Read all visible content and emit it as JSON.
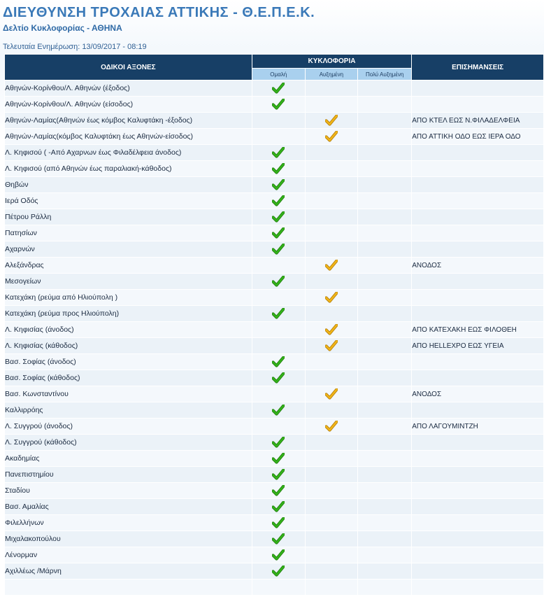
{
  "header": {
    "title": "ΔΙΕΥΘΥΝΣΗ ΤΡΟΧΑΙΑΣ ΑΤΤΙΚΗΣ - Θ.Ε.Π.Ε.Κ.",
    "subtitle": "Δελτίο Κυκλοφορίας - ΑΘΗΝΑ",
    "updated_label": "Τελευταία Ενημέρωση:",
    "updated_value": "13/09/2017 - 08:19"
  },
  "table": {
    "col_roads": "ΟΔΙΚΟΙ ΑΞΟΝΕΣ",
    "col_traffic": "ΚΥΚΛΟΦΟΡΙΑ",
    "col_notes": "ΕΠΙΣΗΜΑΝΣΕΙΣ",
    "levels": [
      "Ομαλή",
      "Αυξημένη",
      "Πολύ Αυξημένη"
    ],
    "rows": [
      {
        "road": "Αθηνών-Κορίνθου/Λ. Αθηνών (έξοδος)",
        "level": 0,
        "note": ""
      },
      {
        "road": "Αθηνών-Κορίνθου/Λ. Αθηνών (είσοδος)",
        "level": 0,
        "note": ""
      },
      {
        "road": "Αθηνών-Λαμίας(Αθηνών έως κόμβος Καλυφτάκη -έξοδος)",
        "level": 1,
        "note": "ΑΠΟ ΚΤΕΛ ΕΩΣ Ν.ΦΙΛΑΔΕΛΦΕΙΑ"
      },
      {
        "road": "Αθηνών-Λαμίας(κόμβος Καλυφτάκη έως Αθηνών-είσοδος)",
        "level": 1,
        "note": "ΑΠΟ ΑΤΤΙΚΗ ΟΔΟ ΕΩΣ ΙΕΡΑ ΟΔΟ"
      },
      {
        "road": "Λ. Κηφισού ( -Από Αχαρνων έως Φιλαδέλφεια άνοδος)",
        "level": 0,
        "note": ""
      },
      {
        "road": "Λ. Κηφισού (από Αθηνών έως παραλιακή-κάθοδος)",
        "level": 0,
        "note": ""
      },
      {
        "road": "Θηβών",
        "level": 0,
        "note": ""
      },
      {
        "road": "Ιερά Οδός",
        "level": 0,
        "note": ""
      },
      {
        "road": "Πέτρου Ράλλη",
        "level": 0,
        "note": ""
      },
      {
        "road": "Πατησίων",
        "level": 0,
        "note": ""
      },
      {
        "road": "Αχαρνών",
        "level": 0,
        "note": ""
      },
      {
        "road": "Αλεξάνδρας",
        "level": 1,
        "note": "ΑΝΟΔΟΣ"
      },
      {
        "road": "Μεσογείων",
        "level": 0,
        "note": ""
      },
      {
        "road": "Κατεχάκη (ρεύμα από Ηλιούπολη )",
        "level": 1,
        "note": ""
      },
      {
        "road": "Κατεχάκη (ρεύμα προς Ηλιούπολη)",
        "level": 0,
        "note": ""
      },
      {
        "road": "Λ. Κηφισίας (άνοδος)",
        "level": 1,
        "note": "ΑΠΟ ΚΑΤΕΧΑΚΗ ΕΩΣ ΦΙΛΟΘΕΗ"
      },
      {
        "road": "Λ. Κηφισίας (κάθοδος)",
        "level": 1,
        "note": "ΑΠΟ HELLEXPO ΕΩΣ ΥΓΕΙΑ"
      },
      {
        "road": "Βασ. Σοφίας (άνοδος)",
        "level": 0,
        "note": ""
      },
      {
        "road": "Βασ. Σοφίας (κάθοδος)",
        "level": 0,
        "note": ""
      },
      {
        "road": "Βασ. Κωνσταντίνου",
        "level": 1,
        "note": "ΑΝΟΔΟΣ"
      },
      {
        "road": "Καλλιρρόης",
        "level": 0,
        "note": ""
      },
      {
        "road": "Λ. Συγγρού (άνοδος)",
        "level": 1,
        "note": "ΑΠΟ ΛΑΓΟΥΜΙΝΤΖΗ"
      },
      {
        "road": "Λ. Συγγρού (κάθοδος)",
        "level": 0,
        "note": ""
      },
      {
        "road": "Ακαδημίας",
        "level": 0,
        "note": ""
      },
      {
        "road": "Πανεπιστημίου",
        "level": 0,
        "note": ""
      },
      {
        "road": "Σταδίου",
        "level": 0,
        "note": ""
      },
      {
        "road": "Βασ. Αμαλίας",
        "level": 0,
        "note": ""
      },
      {
        "road": "Φιλελλήνων",
        "level": 0,
        "note": ""
      },
      {
        "road": "Μιχαλακοπούλου",
        "level": 0,
        "note": ""
      },
      {
        "road": "Λένορμαν",
        "level": 0,
        "note": ""
      },
      {
        "road": "Αχιλλέως /Μάρνη",
        "level": 0,
        "note": ""
      },
      {
        "road": "",
        "level": null,
        "note": ""
      }
    ]
  },
  "icons": {
    "normal": "green-check-icon",
    "increased": "yellow-check-icon"
  },
  "colors": {
    "title": "#3a79b8",
    "header_dark": "#173f66",
    "header_light": "#a9d0ee",
    "row_a": "#ebf2f8",
    "row_b": "#f4f8fc",
    "check_green": "#33b21a",
    "check_yellow": "#f0b418"
  }
}
